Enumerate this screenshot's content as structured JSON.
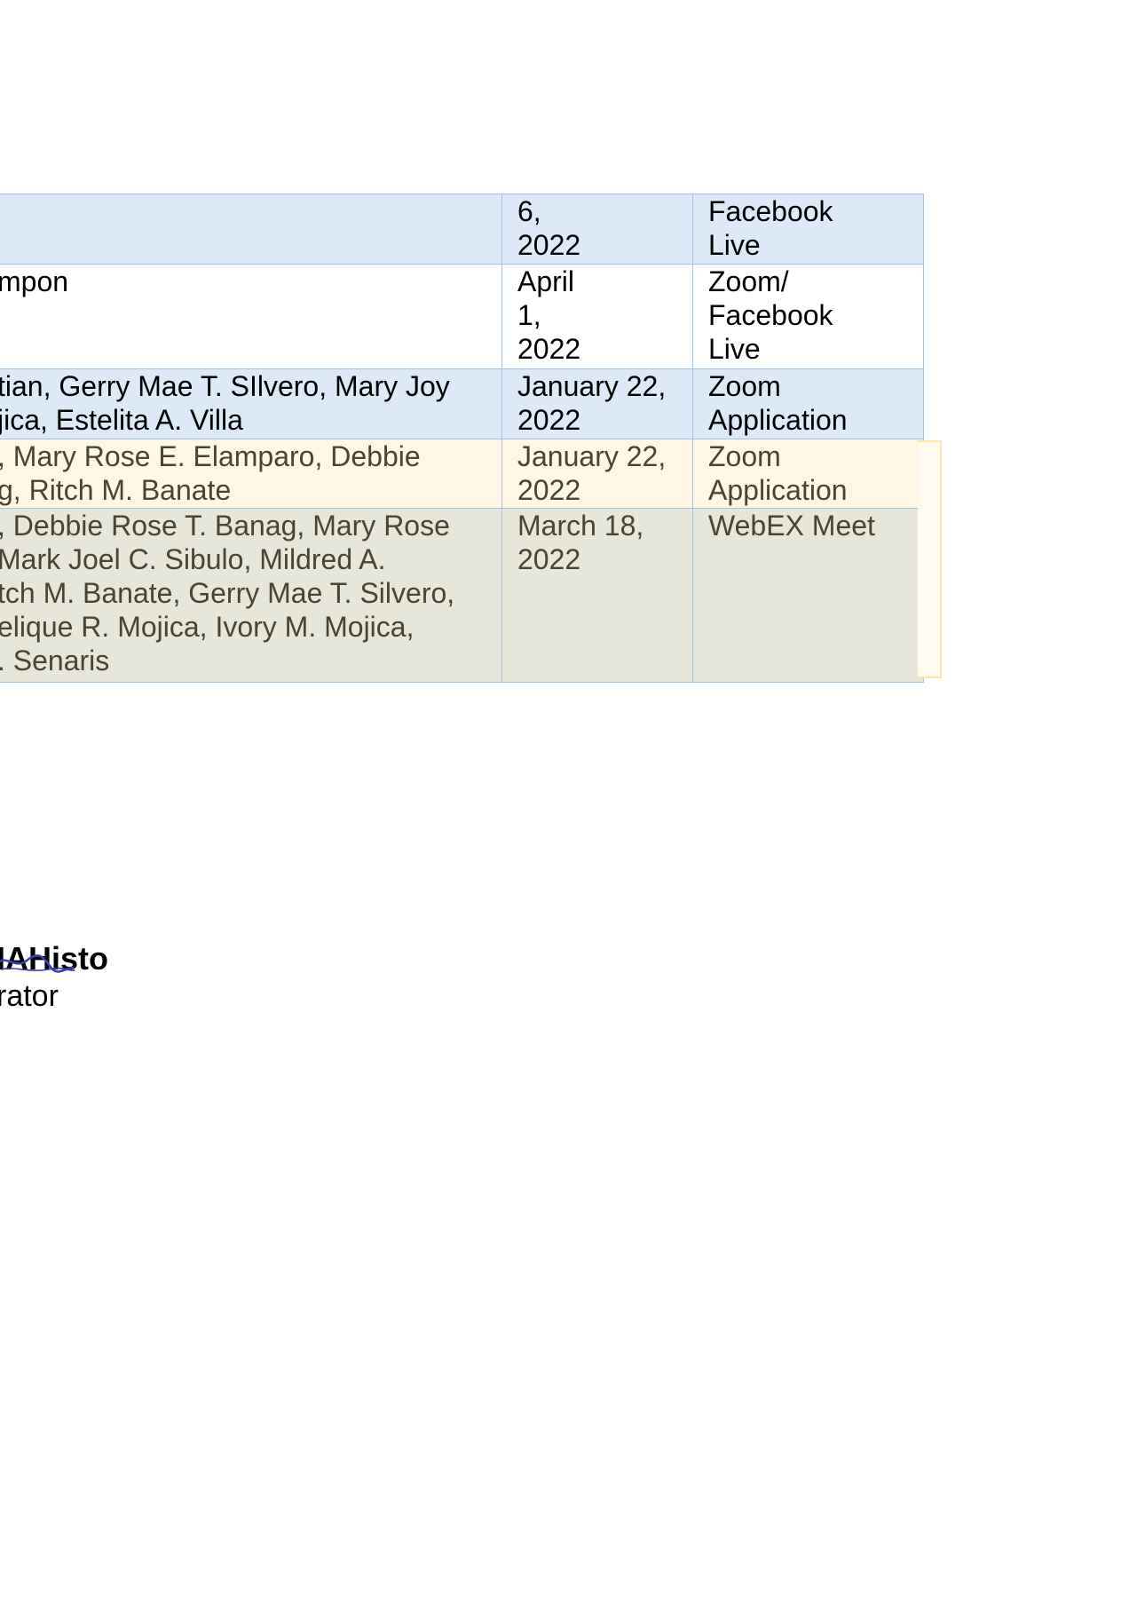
{
  "table": {
    "rows": [
      {
        "style": "blue",
        "participants": "",
        "date": "6,\n2022",
        "mode": "Facebook\nLive"
      },
      {
        "style": "white",
        "participants": "mpon",
        "date": "April\n1,\n2022",
        "mode": "Zoom/\nFacebook\nLive"
      },
      {
        "style": "blue",
        "participants": "tian, Gerry Mae T. SIlvero, Mary Joy\njica, Estelita A. Villa",
        "date": "January 22,\n2022",
        "mode": "Zoom\nApplication"
      },
      {
        "style": "cream",
        "participants": ", Mary Rose E. Elamparo, Debbie\ng, Ritch M. Banate",
        "date": "January 22,\n2022",
        "mode": "Zoom\nApplication"
      },
      {
        "style": "olive",
        "participants": ", Debbie Rose T. Banag, Mary Rose\nMark Joel C. Sibulo, Mildred A.\ntch M. Banate, Gerry Mae T. Silvero,\nelique R. Mojica, Ivory M. Mojica,\n. Senaris",
        "date": "March 18,\n2022",
        "mode": "WebEX Meet"
      }
    ]
  },
  "signature": {
    "name": "IAHisto",
    "title": "rator"
  },
  "colors": {
    "header_blue": "#dde9f6",
    "border_blue": "#9dc3e6",
    "cream": "#fff7e3",
    "olive": "#e6e6db",
    "olive_text": "#4a4430",
    "frame_yellow": "#fde7a6",
    "signature_ink": "#3a3fb3"
  }
}
